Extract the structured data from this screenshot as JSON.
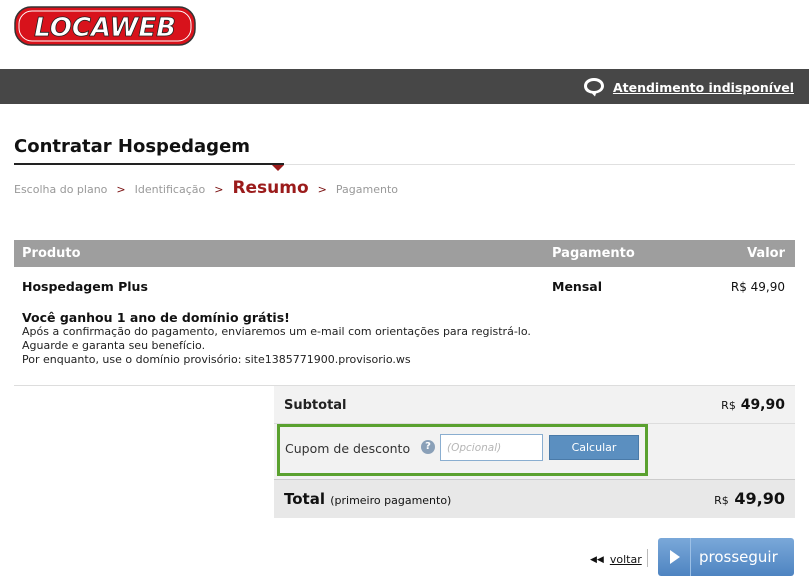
{
  "brand": {
    "logo_text": "LOCAWEB",
    "logo_red": "#d8121b"
  },
  "support": {
    "label": "Atendimento indisponível",
    "icon": "chat-bubble-icon"
  },
  "page": {
    "title": "Contratar Hospedagem"
  },
  "steps": [
    {
      "label": "Escolha do plano",
      "active": false
    },
    {
      "label": "Identificação",
      "active": false
    },
    {
      "label": "Resumo",
      "active": true
    },
    {
      "label": "Pagamento",
      "active": false
    }
  ],
  "steps_separator": ">",
  "table": {
    "headers": {
      "product": "Produto",
      "payment": "Pagamento",
      "value": "Valor"
    },
    "row": {
      "product": "Hospedagem Plus",
      "payment": "Mensal",
      "value": "R$ 49,90",
      "promo_title": "Você ganhou 1 ano de domínio grátis!",
      "promo_line1": "Após a confirmação do pagamento, enviaremos um e-mail com orientações para registrá-lo. Aguarde e garanta seu benefício.",
      "promo_line2": "Por enquanto, use o domínio provisório: site1385771900.provisorio.ws"
    }
  },
  "summary": {
    "subtotal_label": "Subtotal",
    "subtotal_currency": "R$",
    "subtotal_value": "49,90",
    "coupon_label": "Cupom de desconto",
    "coupon_help": "?",
    "coupon_placeholder": "(Opcional)",
    "coupon_value": "",
    "calc_label": "Calcular",
    "total_label": "Total",
    "total_note": "(primeiro pagamento)",
    "total_currency": "R$",
    "total_value": "49,90"
  },
  "actions": {
    "back_label": "voltar",
    "back_icon": "double-left-arrow-icon",
    "next_label": "prosseguir",
    "next_icon": "play-icon"
  },
  "colors": {
    "topbar": "#474747",
    "accent_red": "#9b1b1b",
    "coupon_border": "#5aa12f",
    "button_blue": "#5b8fc0"
  }
}
